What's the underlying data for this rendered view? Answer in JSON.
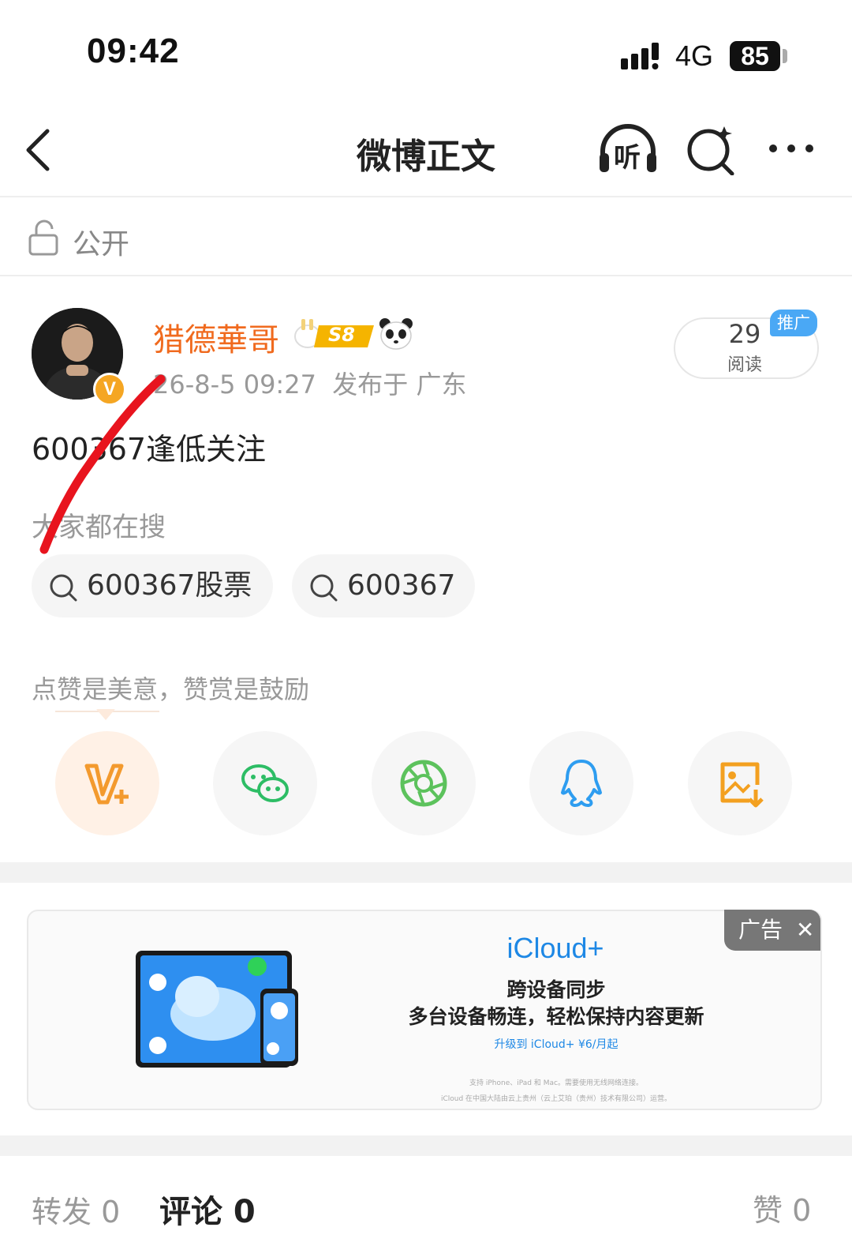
{
  "status_bar": {
    "time": "09:42",
    "network": "4G",
    "battery": "85"
  },
  "nav": {
    "title": "微博正文",
    "listen_label": "听"
  },
  "visibility": "公开",
  "post": {
    "username": "猎德華哥",
    "level": "S8",
    "verified_badge": "V",
    "meta": "26-8-5 09:27  发布于 广东",
    "reads_count": "29",
    "reads_label": "阅读",
    "promo_label": "推广",
    "text": "600367逢低关注"
  },
  "search": {
    "label": "大家都在搜",
    "chips": [
      "600367股票",
      "600367"
    ]
  },
  "like_prompt": "点赞是美意，赞赏是鼓励",
  "share_icons": [
    "weibo-v-plus-icon",
    "wechat-icon",
    "moments-icon",
    "qq-icon",
    "save-image-icon"
  ],
  "ad": {
    "tag": "广告",
    "brand": "iCloud+",
    "line1": "跨设备同步",
    "line2": "多台设备畅连，轻松保持内容更新",
    "cta": "升级到 iCloud+ ¥6/月起",
    "fine1": "支持 iPhone、iPad 和 Mac。需要使用无线网络连接。",
    "fine2": "iCloud 在中国大陆由云上贵州（云上艾珀（贵州）技术有限公司）运营。"
  },
  "tabs": {
    "repost": "转发 0",
    "comment": "评论 0",
    "like": "赞 0"
  },
  "colors": {
    "accent": "#f06a1e",
    "promo": "#4aa8f5",
    "annotation": "#e8141e"
  }
}
